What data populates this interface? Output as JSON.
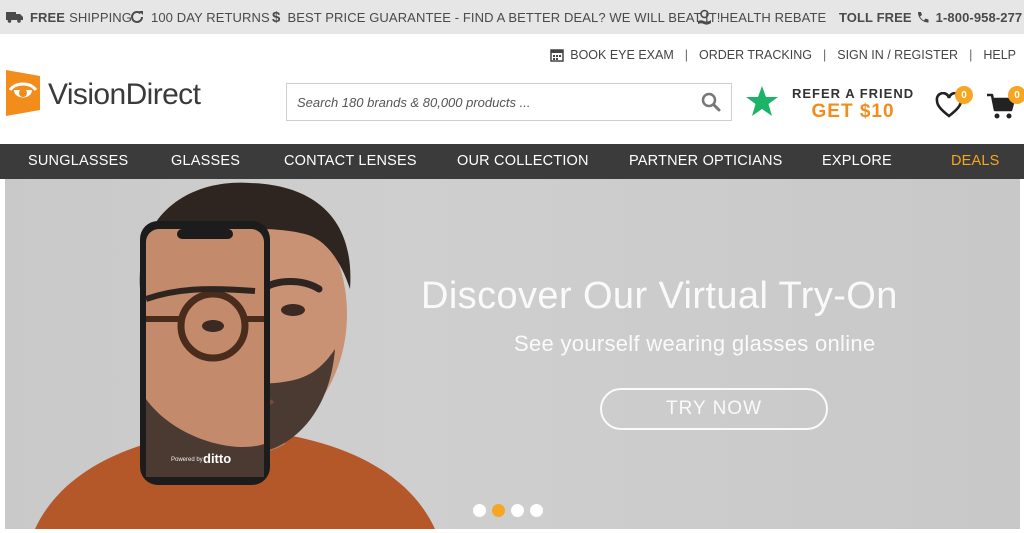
{
  "promo": {
    "shipping_bold": "FREE",
    "shipping_text": "SHIPPING",
    "returns": "100 DAY RETURNS",
    "guarantee": "BEST PRICE GUARANTEE - FIND A BETTER DEAL? WE WILL BEAT IT!",
    "rebate": "HEALTH REBATE",
    "toll_label": "TOLL FREE",
    "phone": "1-800-958-277"
  },
  "util_links": {
    "eye_exam": "BOOK EYE EXAM",
    "order_tracking": "ORDER TRACKING",
    "sign_in": "SIGN IN / REGISTER",
    "help": "HELP",
    "separator": "|"
  },
  "logo": {
    "text": "VisionDirect"
  },
  "search": {
    "placeholder": "Search 180 brands & 80,000 products ..."
  },
  "refer": {
    "line1": "REFER A FRIEND",
    "line2": "GET $10"
  },
  "wishlist": {
    "count": "0"
  },
  "cart": {
    "count": "0"
  },
  "nav": [
    {
      "label": "SUNGLASSES"
    },
    {
      "label": "GLASSES"
    },
    {
      "label": "CONTACT LENSES"
    },
    {
      "label": "OUR COLLECTION"
    },
    {
      "label": "PARTNER OPTICIANS"
    },
    {
      "label": "EXPLORE"
    },
    {
      "label": "DEALS"
    }
  ],
  "hero": {
    "title": "Discover Our Virtual Try-On",
    "subtitle": "See yourself wearing glasses online",
    "button": "TRY NOW",
    "phone_caption_small": "Powered by",
    "phone_caption_brand": "ditto",
    "slides_total": 4,
    "slide_active": 2
  },
  "colors": {
    "accent": "#f5a623",
    "nav_bg": "#3b3b3b",
    "promo_bg": "#e6e6e6",
    "star_green": "#1db366"
  }
}
